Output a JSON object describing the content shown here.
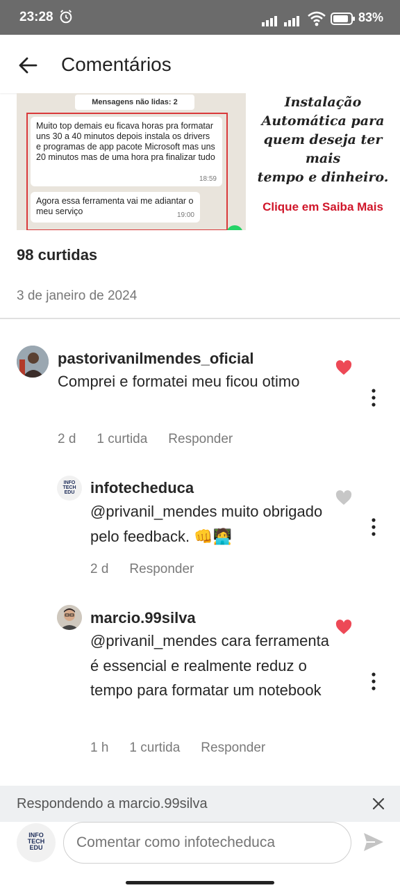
{
  "status_bar": {
    "time": "23:28",
    "battery": "83%"
  },
  "header": {
    "title": "Comentários"
  },
  "post_image": {
    "unread_label": "Mensagens não lidas: 2",
    "bubble1_text": "Muito top demais eu ficava horas pra formatar uns 30 a 40 minutos depois instala os drivers e programas de app pacote Microsoft mas uns 20 minutos mas de uma hora pra finalizar tudo",
    "bubble1_time": "18:59",
    "bubble2_text": "Agora essa ferramenta vai me adiantar o meu serviço",
    "bubble2_time": "19:00",
    "promo_line1": "Instalação",
    "promo_line2": "Automática para",
    "promo_line3": "quem deseja ter mais",
    "promo_line4": "tempo e dinheiro.",
    "promo_cta": "Clique em Saiba Mais"
  },
  "post": {
    "likes": "98 curtidas",
    "date": "3 de janeiro de 2024"
  },
  "comments": [
    {
      "username": "pastorivanilmendes_oficial",
      "text": "Comprei e formatei meu ficou otimo",
      "age": "2 d",
      "likes": "1 curtida",
      "reply": "Responder",
      "liked": true
    },
    {
      "username": "infotecheduca",
      "text": "@privanil_mendes muito obrigado pelo feedback. 👊🧑‍💻",
      "age": "2 d",
      "likes": "",
      "reply": "Responder",
      "liked": false
    },
    {
      "username": "marcio.99silva",
      "text": "@privanil_mendes cara ferramenta é essencial e realmente reduz o tempo para formatar um notebook",
      "age": "1 h",
      "likes": "1 curtida",
      "reply": "Responder",
      "liked": true
    }
  ],
  "reply_bar": {
    "text": "Respondendo a marcio.99silva"
  },
  "composer": {
    "placeholder": "Comentar como infotecheduca"
  },
  "logo": {
    "line1": "INFO",
    "line2": "TECH",
    "line3": "EDU"
  },
  "colors": {
    "heart_liked": "#ed4956",
    "heart_unliked": "#c7c7c7",
    "promo_red": "#d0162a"
  },
  "icons": [
    "alarm-icon",
    "signal-icon",
    "wifi-icon",
    "battery-icon",
    "back-arrow-icon",
    "heart-icon",
    "more-vert-icon",
    "close-icon",
    "send-icon"
  ]
}
